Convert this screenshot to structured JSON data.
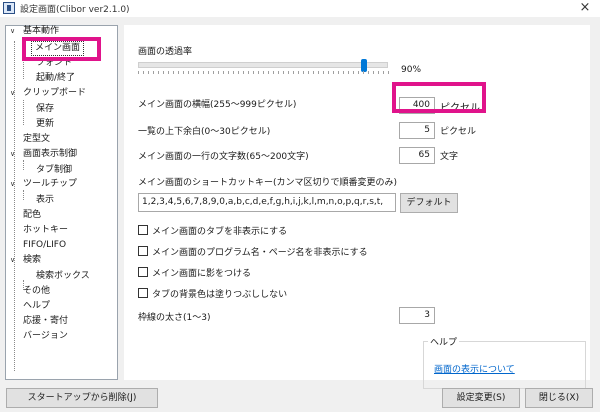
{
  "window": {
    "title": "設定画面(Clibor ver2.1.0)",
    "close_glyph": "×"
  },
  "tree": {
    "items": [
      {
        "label": "基本動作",
        "chevron": "∨"
      },
      {
        "label": "メイン画面"
      },
      {
        "label": "フォント"
      },
      {
        "label": "起動/終了"
      },
      {
        "label": "クリップボード",
        "chevron": "∨"
      },
      {
        "label": "保存"
      },
      {
        "label": "更新"
      },
      {
        "label": "定型文"
      },
      {
        "label": "画面表示制御",
        "chevron": "∨"
      },
      {
        "label": "タブ制御"
      },
      {
        "label": "ツールチップ",
        "chevron": "∨"
      },
      {
        "label": "表示"
      },
      {
        "label": "配色"
      },
      {
        "label": "ホットキー"
      },
      {
        "label": "FIFO/LIFO"
      },
      {
        "label": "検索",
        "chevron": "∨"
      },
      {
        "label": "検索ボックス"
      },
      {
        "label": "その他"
      },
      {
        "label": "ヘルプ"
      },
      {
        "label": "応援・寄付"
      },
      {
        "label": "バージョン"
      }
    ]
  },
  "main": {
    "transparency_label": "画面の透過率",
    "transparency_value": "90%",
    "transparency_level": 0.9,
    "width_label": "メイン画面の横幅(255～999ピクセル)",
    "width_value": "400",
    "width_unit": "ピクセル",
    "margin_label": "一覧の上下余白(0～30ピクセル)",
    "margin_value": "5",
    "margin_unit": "ピクセル",
    "chars_label": "メイン画面の一行の文字数(65～200文字)",
    "chars_value": "65",
    "chars_unit": "文字",
    "shortcut_label": "メイン画面のショートカットキー(カンマ区切りで順番変更のみ)",
    "shortcut_value": "1,2,3,4,5,6,7,8,9,0,a,b,c,d,e,f,g,h,i,j,k,l,m,n,o,p,q,r,s,t,",
    "default_button": "デフォルト",
    "checkboxes": [
      "メイン画面のタブを非表示にする",
      "メイン画面のプログラム名・ページ名を非表示にする",
      "メイン画面に影をつける",
      "タブの背景色は塗りつぶししない"
    ],
    "border_label": "枠線の太さ(1～3)",
    "border_value": "3",
    "help_legend": "ヘルプ",
    "help_link": "画面の表示について"
  },
  "footer": {
    "remove_startup": "スタートアップから削除(J)",
    "apply": "設定変更(S)",
    "close": "閉じる(X)"
  },
  "colors": {
    "highlight": "#e0138b",
    "accent": "#0078d7",
    "link": "#0066cc"
  }
}
